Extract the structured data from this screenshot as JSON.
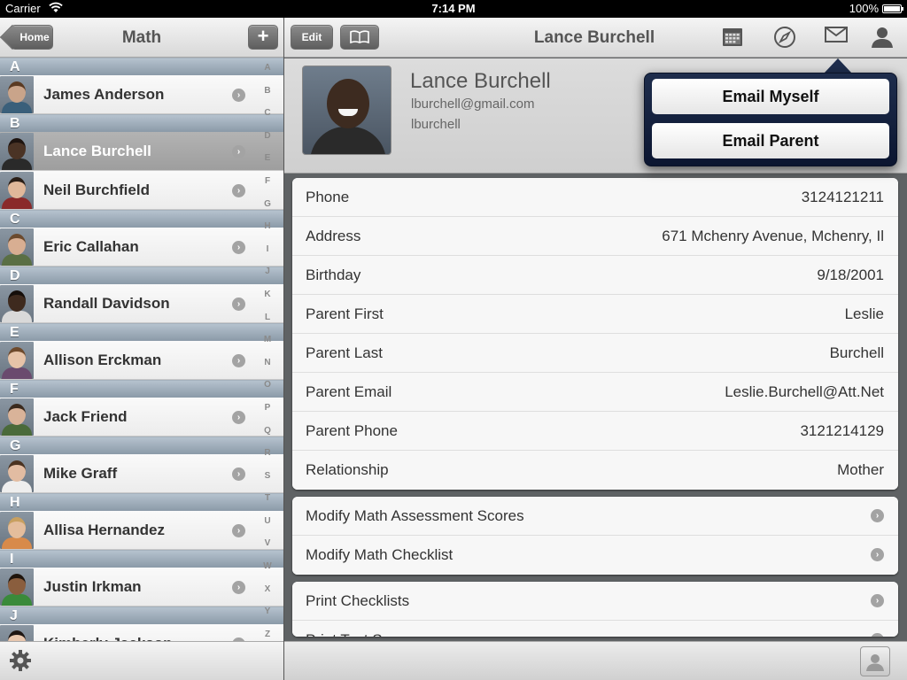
{
  "status_bar": {
    "carrier": "Carrier",
    "time": "7:14 PM",
    "battery": "100%"
  },
  "left_nav": {
    "back_label": "Home",
    "title": "Math",
    "add_label": "+"
  },
  "right_nav": {
    "edit_label": "Edit",
    "title": "Lance Burchell"
  },
  "students": [
    {
      "section": "A",
      "name": "James Anderson",
      "skin": "#c9a48a",
      "hair": "#5a3a22",
      "shirt": "#3a5f7a"
    },
    {
      "section": "B",
      "name": "Lance Burchell",
      "skin": "#4a3325",
      "hair": "#1e1410",
      "shirt": "#2a2a2a",
      "selected": true
    },
    {
      "section": null,
      "name": "Neil Burchfield",
      "skin": "#e0b89a",
      "hair": "#2a1e16",
      "shirt": "#8a2a2a"
    },
    {
      "section": "C",
      "name": "Eric Callahan",
      "skin": "#d8ae92",
      "hair": "#6b4a2e",
      "shirt": "#5a6f44"
    },
    {
      "section": "D",
      "name": "Randall Davidson",
      "skin": "#3e2a1e",
      "hair": "#150e0a",
      "shirt": "#d9d9d9"
    },
    {
      "section": "E",
      "name": "Allison Erckman",
      "skin": "#e6c3a8",
      "hair": "#6e4a2c",
      "shirt": "#6a4a6e"
    },
    {
      "section": "F",
      "name": "Jack Friend",
      "skin": "#d9b399",
      "hair": "#3a2a1e",
      "shirt": "#4a6a3a"
    },
    {
      "section": "G",
      "name": "Mike Graff",
      "skin": "#e2bca2",
      "hair": "#4a3220",
      "shirt": "#eeeeee"
    },
    {
      "section": "H",
      "name": "Allisa Hernandez",
      "skin": "#e4bd9c",
      "hair": "#c8a060",
      "shirt": "#d88a4a"
    },
    {
      "section": "I",
      "name": "Justin Irkman",
      "skin": "#8a5e3e",
      "hair": "#1e140c",
      "shirt": "#3a8a3a"
    },
    {
      "section": "J",
      "name": "Kimberly Jackson",
      "skin": "#e8c7ae",
      "hair": "#1e1612",
      "shirt": "#2e2e2e"
    }
  ],
  "index_letters": [
    "A",
    "B",
    "C",
    "D",
    "E",
    "F",
    "G",
    "H",
    "I",
    "J",
    "K",
    "L",
    "M",
    "N",
    "O",
    "P",
    "Q",
    "R",
    "S",
    "T",
    "U",
    "V",
    "W",
    "X",
    "Y",
    "Z",
    "#"
  ],
  "profile": {
    "name": "Lance Burchell",
    "email": "lburchell@gmail.com",
    "username": "lburchell"
  },
  "details": [
    {
      "label": "Phone",
      "value": "3124121211"
    },
    {
      "label": "Address",
      "value": "671 Mchenry Avenue, Mchenry, Il"
    },
    {
      "label": "Birthday",
      "value": "9/18/2001"
    },
    {
      "label": "Parent First",
      "value": "Leslie"
    },
    {
      "label": "Parent Last",
      "value": "Burchell"
    },
    {
      "label": "Parent Email",
      "value": "Leslie.Burchell@Att.Net"
    },
    {
      "label": "Parent Phone",
      "value": "3121214129"
    },
    {
      "label": "Relationship",
      "value": "Mother"
    }
  ],
  "actions_1": [
    {
      "label": "Modify Math Assessment Scores"
    },
    {
      "label": "Modify Math Checklist"
    }
  ],
  "actions_2": [
    {
      "label": "Print Checklists"
    },
    {
      "label": "Print Test S..."
    }
  ],
  "popover": {
    "email_myself": "Email Myself",
    "email_parent": "Email Parent"
  },
  "icons": {
    "calendar": "calendar-icon",
    "compass": "compass-icon",
    "mail": "mail-icon",
    "person": "person-icon",
    "gear": "gear-icon"
  }
}
